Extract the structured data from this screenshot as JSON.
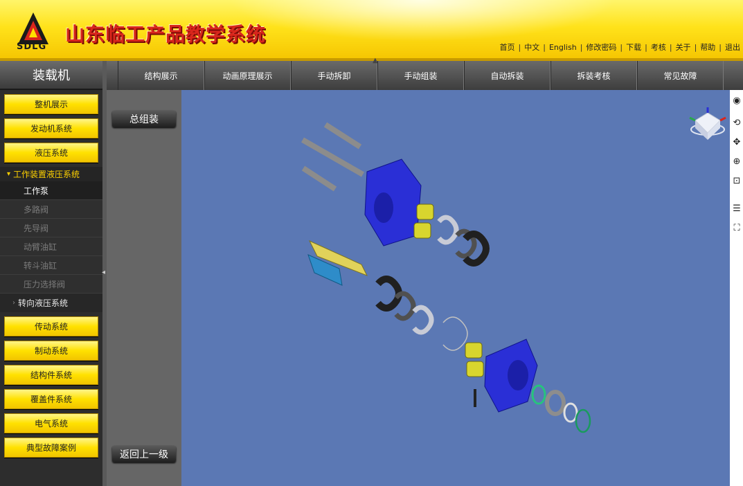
{
  "header": {
    "app_title": "山东临工产品教学系统",
    "logo_text": "SDLG",
    "links": [
      "首页",
      "中文",
      "English",
      "修改密码",
      "下载",
      "考核",
      "关于",
      "帮助",
      "退出"
    ]
  },
  "sidebar": {
    "product_title": "装载机",
    "categories_top": [
      "整机展示",
      "发动机系统",
      "液压系统"
    ],
    "expanded_group": "工作装置液压系统",
    "sub_items": [
      "工作泵",
      "多路阀",
      "先导阀",
      "动臂油缸",
      "转斗油缸",
      "压力选择阀"
    ],
    "collapsed_group": "转向液压系统",
    "categories_bottom": [
      "传动系统",
      "制动系统",
      "结构件系统",
      "覆盖件系统",
      "电气系统",
      "典型故障案例"
    ]
  },
  "tabs": [
    "结构展示",
    "动画原理展示",
    "手动拆卸",
    "手动组装",
    "自动拆装",
    "拆装考核",
    "常见故障"
  ],
  "panel": {
    "top_button": "总组装",
    "bottom_button": "返回上一级"
  },
  "colors": {
    "brand_yellow": "#ffe100",
    "brand_red": "#d9261c",
    "viewer_bg": "#5b78b4",
    "part_blue": "#2a2fd6"
  },
  "icons": {
    "nav_cube": "view-cube-icon",
    "tools": [
      "rotate-icon",
      "pan-icon",
      "zoom-icon",
      "zoom-window-icon",
      "tree-icon",
      "fit-icon"
    ]
  }
}
